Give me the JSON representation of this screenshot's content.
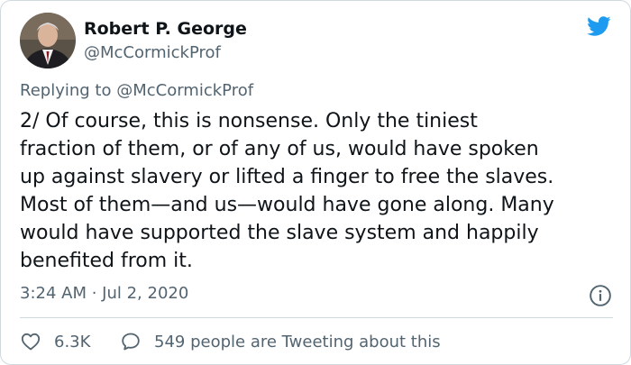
{
  "author": {
    "name": "Robert P. George",
    "handle": "@McCormickProf"
  },
  "reply_context": {
    "prefix": "Replying to",
    "mention": "@McCormickProf"
  },
  "tweet": {
    "lines": [
      "2/ Of course, this is nonsense. Only the tiniest",
      "fraction of them, or of any of us, would have spoken",
      "up against slavery or lifted a finger to free the slaves.",
      "Most of them—and us—would have gone along. Many",
      "would have supported the slave system and happily",
      "benefited from it."
    ],
    "timestamp": "3:24 AM · Jul 2, 2020"
  },
  "actions": {
    "like_count": "6.3K",
    "reply_text": "549 people are Tweeting about this"
  },
  "icons": {
    "brand": "twitter-bird-icon",
    "info": "info-icon",
    "like": "heart-icon",
    "reply": "speech-bubble-icon"
  },
  "colors": {
    "brand_blue": "#1d9bf0",
    "text_primary": "#0f1419",
    "text_secondary": "#536471",
    "border": "#cfd9de"
  }
}
